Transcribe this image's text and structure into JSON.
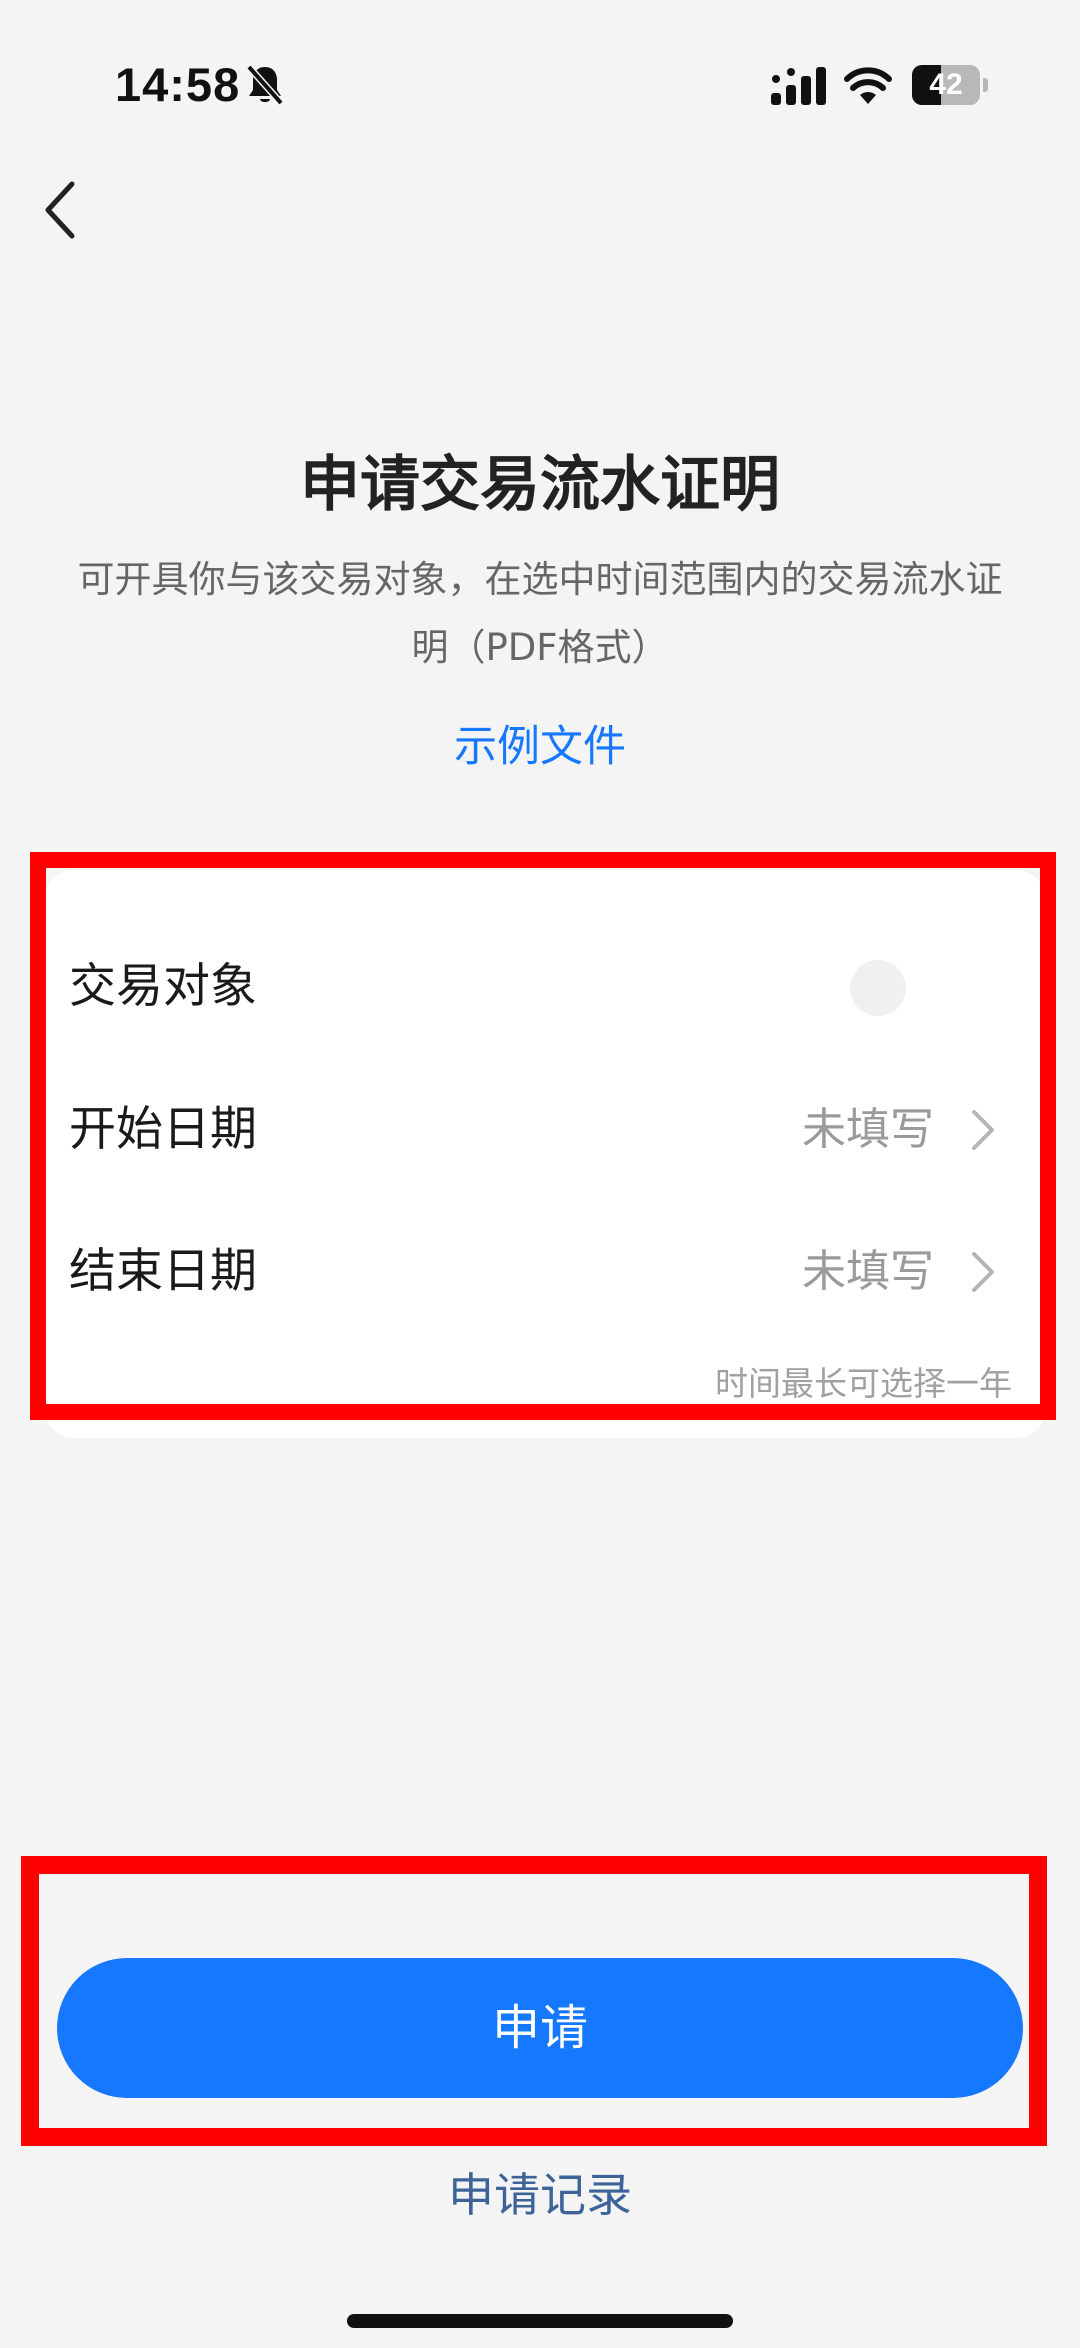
{
  "status_bar": {
    "time": "14:58",
    "battery_level": "42",
    "battery_fraction": 0.42,
    "icons": [
      "bell-slash-icon",
      "signal-icon",
      "wifi-icon",
      "battery-icon"
    ]
  },
  "header": {
    "back_icon": "chevron-left-icon"
  },
  "main": {
    "title": "申请交易流水证明",
    "description": "可开具你与该交易对象，在选中时间范围内的交易流水证明（PDF格式）",
    "sample_link": "示例文件"
  },
  "form": {
    "rows": [
      {
        "label": "交易对象",
        "value": ""
      },
      {
        "label": "开始日期",
        "value": "未填写"
      },
      {
        "label": "结束日期",
        "value": "未填写"
      }
    ],
    "hint": "时间最长可选择一年"
  },
  "actions": {
    "apply_label": "申请",
    "history_label": "申请记录"
  },
  "colors": {
    "accent": "#1677ff",
    "highlight": "#ff0000",
    "background": "#f4f4f5",
    "history_link": "#3d6399"
  }
}
